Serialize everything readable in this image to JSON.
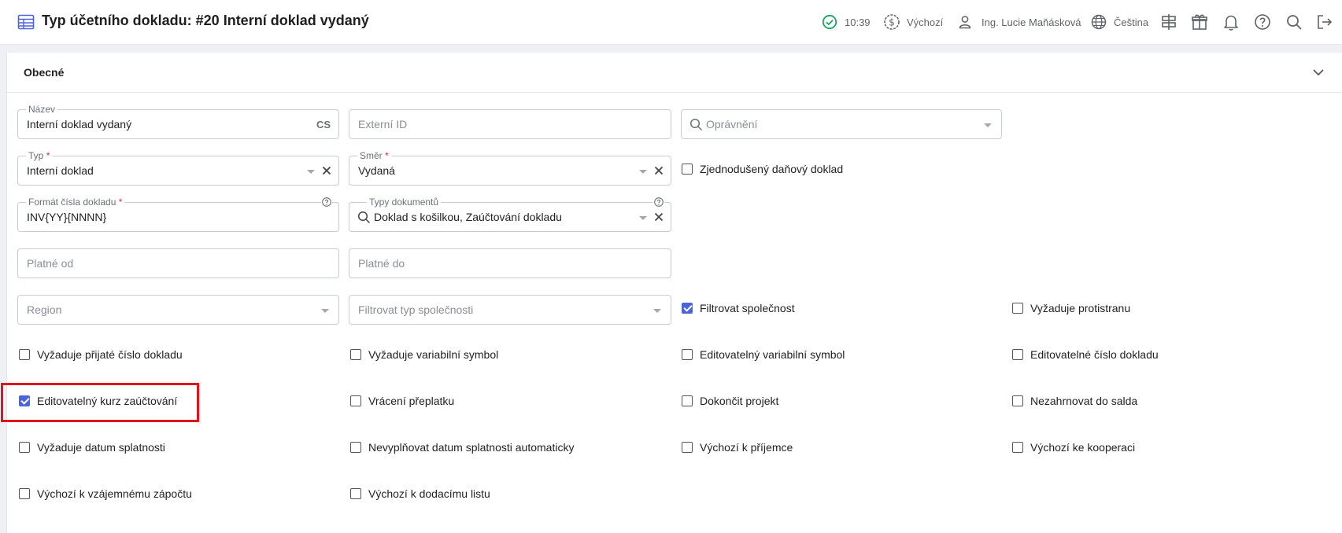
{
  "header": {
    "title": "Typ účetního dokladu: #20 Interní doklad vydaný",
    "time": "10:39",
    "currency": "Výchozí",
    "user": "Ing. Lucie Maňásková",
    "language": "Čeština"
  },
  "section": {
    "title": "Obecné"
  },
  "fields": {
    "nazev": {
      "label": "Název",
      "value": "Interní doklad vydaný",
      "suffix": "CS"
    },
    "externi_id": {
      "placeholder": "Externí ID"
    },
    "opravneni": {
      "placeholder": "Oprávnění"
    },
    "typ": {
      "label": "Typ",
      "required": "*",
      "value": "Interní doklad"
    },
    "smer": {
      "label": "Směr",
      "required": "*",
      "value": "Vydaná"
    },
    "format": {
      "label": "Formát čísla dokladu",
      "required": "*",
      "value": "INV{YY}{NNNN}"
    },
    "typy_dokumentu": {
      "label": "Typy dokumentů",
      "value": "Doklad s košilkou, Zaúčtování dokladu"
    },
    "platne_od": {
      "placeholder": "Platné od"
    },
    "platne_do": {
      "placeholder": "Platné do"
    },
    "region": {
      "placeholder": "Region"
    },
    "filtrovat_typ": {
      "placeholder": "Filtrovat typ společnosti"
    }
  },
  "checkboxes": {
    "zjednoduseny": {
      "label": "Zjednodušený daňový doklad",
      "checked": false
    },
    "filtrovat_spolecnost": {
      "label": "Filtrovat společnost",
      "checked": true
    },
    "vyzaduje_protistranu": {
      "label": "Vyžaduje protistranu",
      "checked": false
    },
    "vyzaduje_prijate_cislo": {
      "label": "Vyžaduje přijaté číslo dokladu",
      "checked": false
    },
    "vyzaduje_variabilni": {
      "label": "Vyžaduje variabilní symbol",
      "checked": false
    },
    "editovatelny_variabilni": {
      "label": "Editovatelný variabilní symbol",
      "checked": false
    },
    "editovatelne_cislo": {
      "label": "Editovatelné číslo dokladu",
      "checked": false
    },
    "editovatelny_kurz": {
      "label": "Editovatelný kurz zaúčtování",
      "checked": true
    },
    "vraceni_preplatku": {
      "label": "Vrácení přeplatku",
      "checked": false
    },
    "dokoncit_projekt": {
      "label": "Dokončit projekt",
      "checked": false
    },
    "nezahrnovat_salda": {
      "label": "Nezahrnovat do salda",
      "checked": false
    },
    "vyzaduje_splatnosti": {
      "label": "Vyžaduje datum splatnosti",
      "checked": false
    },
    "nevyplnovat_splatnosti": {
      "label": "Nevyplňovat datum splatnosti automaticky",
      "checked": false
    },
    "vychozi_prijemce": {
      "label": "Výchozí k příjemce",
      "checked": false
    },
    "vychozi_kooperaci": {
      "label": "Výchozí ke kooperaci",
      "checked": false
    },
    "vychozi_zapoctu": {
      "label": "Výchozí k vzájemnému zápočtu",
      "checked": false
    },
    "vychozi_dodacimu": {
      "label": "Výchozí k dodacímu listu",
      "checked": false
    }
  },
  "colors": {
    "accent": "#4b64d8",
    "highlight": "#e0141c",
    "status_ok": "#1aa260"
  },
  "icons": [
    "table-icon",
    "status-ok-icon",
    "currency-icon",
    "user-icon",
    "globe-icon",
    "signpost-icon",
    "gift-icon",
    "bell-icon",
    "help-icon",
    "search-icon",
    "logout-icon",
    "chevron-down-icon"
  ]
}
